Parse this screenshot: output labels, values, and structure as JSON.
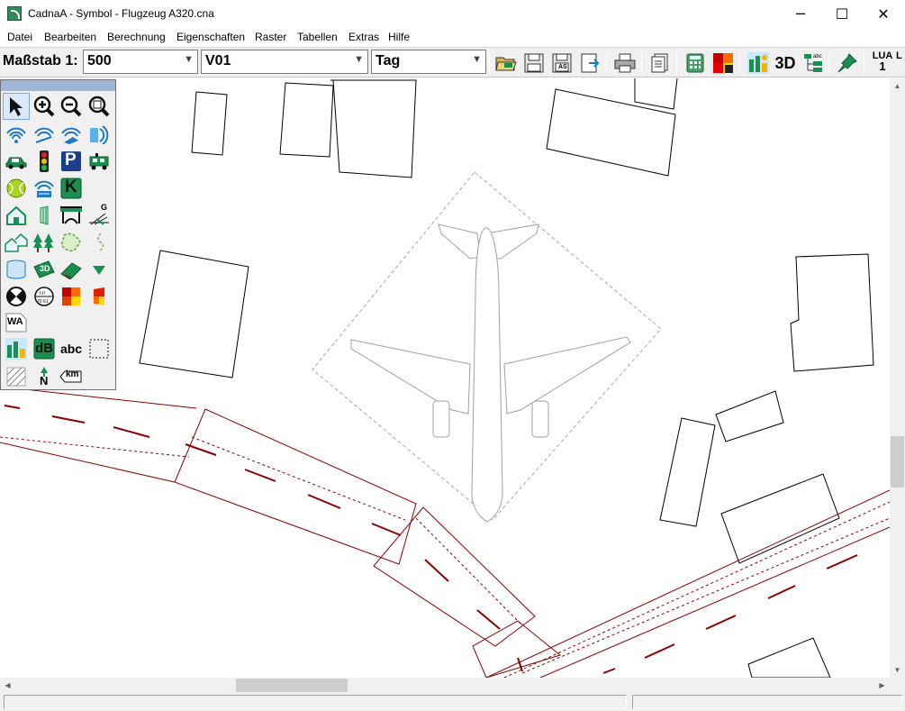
{
  "window": {
    "title": "CadnaA - Symbol - Flugzeug A320.cna",
    "controls": {
      "minimize": "─",
      "maximize": "☐",
      "close": "✕"
    }
  },
  "menu": [
    "Datei",
    "Bearbeiten",
    "Berechnung",
    "Eigenschaften",
    "Raster",
    "Tabellen",
    "Extras",
    "Hilfe"
  ],
  "toolbar": {
    "scale_label": "Maßstab 1:",
    "scale_value": "500",
    "variant_value": "V01",
    "period_value": "Tag",
    "three_d_label": "3D",
    "lua_label": "LUA",
    "lua_value": "1",
    "overflow_label": "L",
    "as_badge": "AS"
  },
  "palette": {
    "text_wa": "WA",
    "text_db": "dB",
    "text_abc": "abc",
    "text_km": "km",
    "text_g": "G",
    "text_3d": "3D",
    "text_k": "K",
    "text_p": "P",
    "text_n": "N"
  },
  "colors": {
    "road": "#8b0000",
    "building": "#000000",
    "aircraft": "#a0a0a0",
    "accent_blue": "#1e78c8",
    "accent_green": "#1a8f50"
  }
}
